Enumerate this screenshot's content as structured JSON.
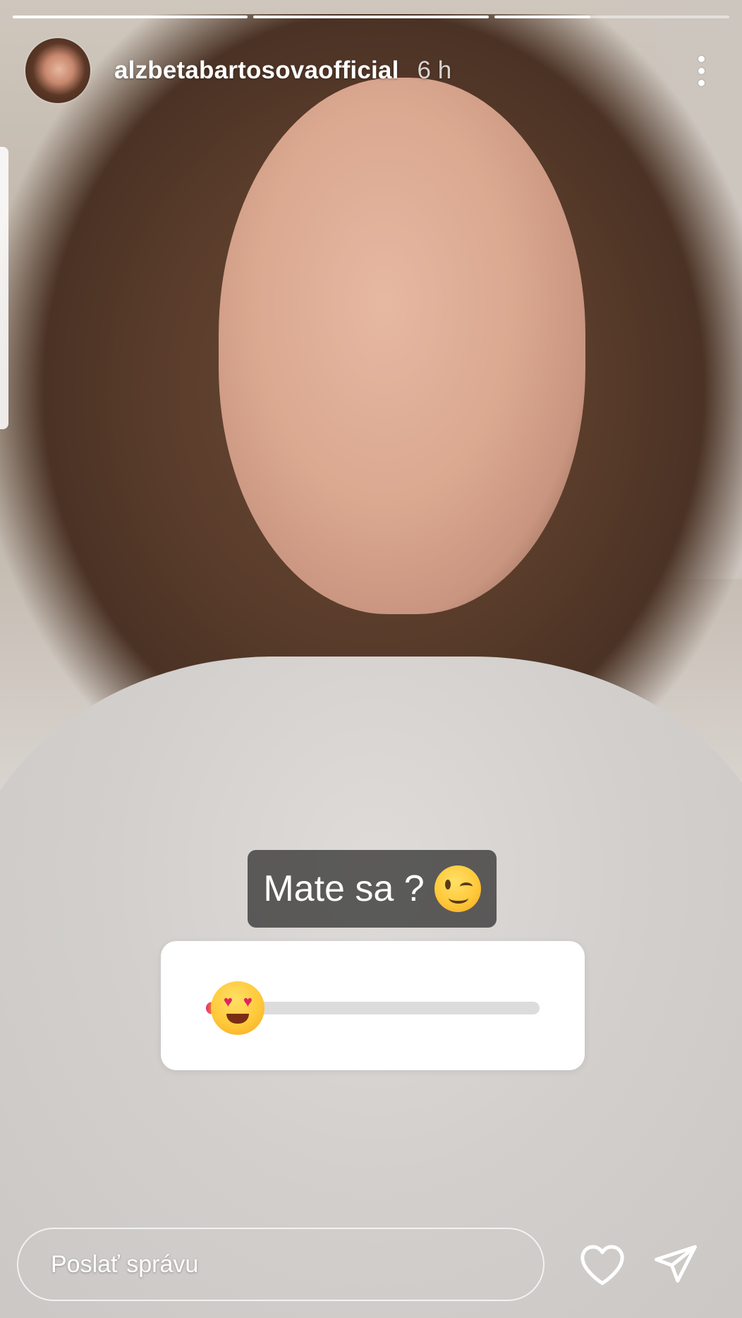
{
  "progress": {
    "segments": [
      {
        "fill": 1.0
      },
      {
        "fill": 1.0
      },
      {
        "fill": 0.41
      }
    ]
  },
  "header": {
    "username": "alzbetabartosovaofficial",
    "time": "6 h",
    "avatar_icon": "profile-avatar",
    "more_icon": "more-vertical-icon"
  },
  "sticker": {
    "question": "Mate sa ?",
    "question_emoji_icon": "winking-face-icon",
    "slider_emoji_icon": "smiling-face-with-heart-eyes-icon",
    "slider_value": 0.02
  },
  "composer": {
    "placeholder": "Poslať správu",
    "like_icon": "heart-icon",
    "share_icon": "send-icon"
  },
  "colors": {
    "accent_gradient_start": "#e1306c",
    "accent_gradient_end": "#f77737",
    "overlay": "#ffffff"
  }
}
